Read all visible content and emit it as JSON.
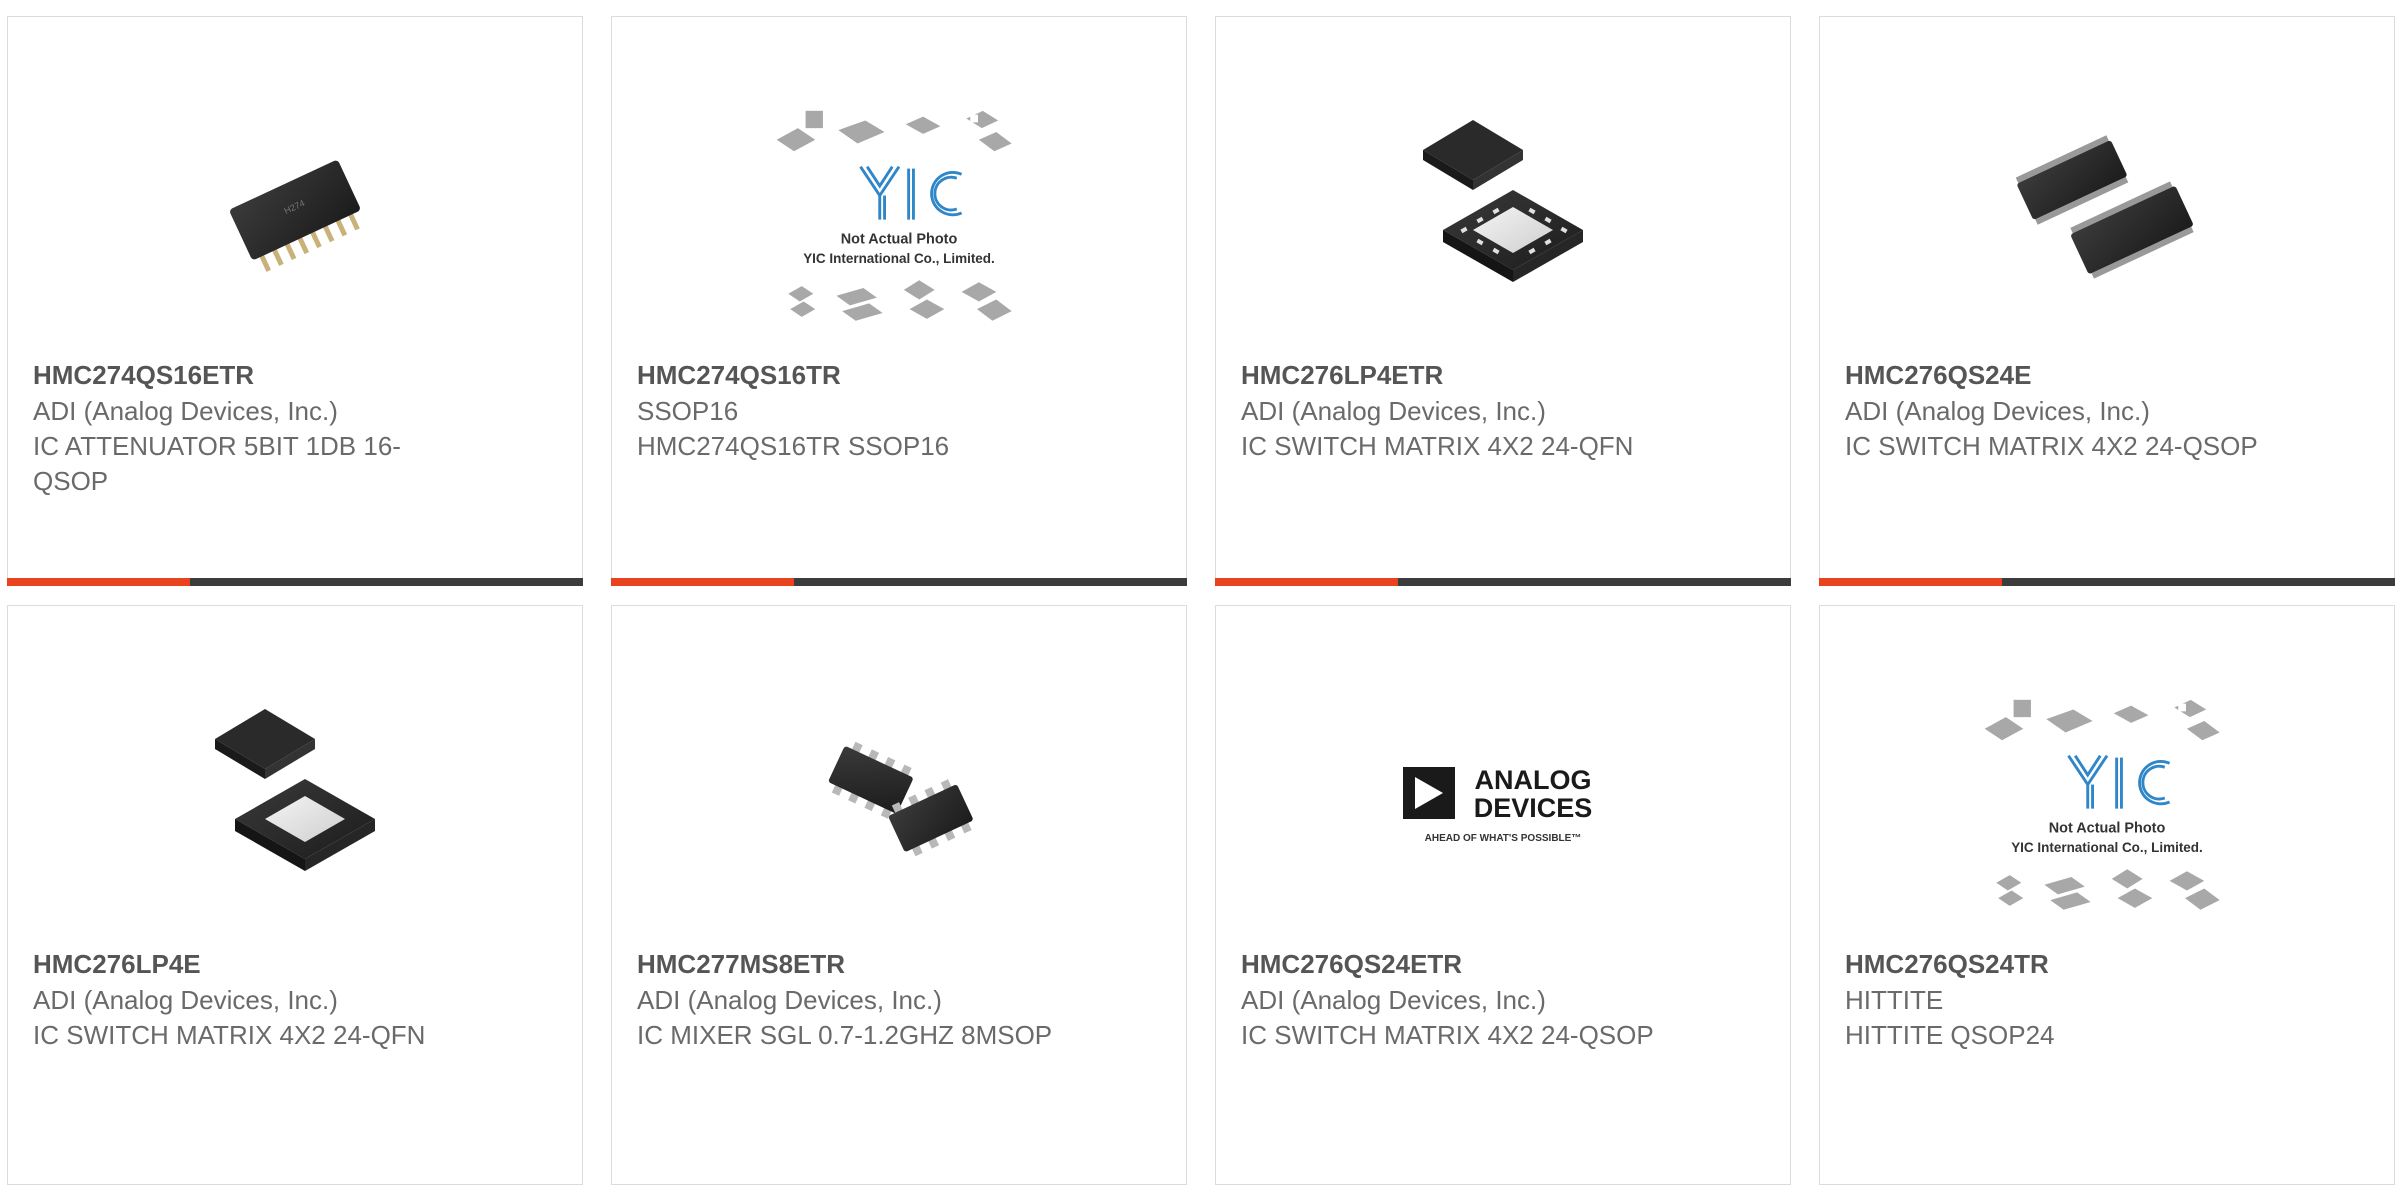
{
  "colors": {
    "accent": "#e8431e",
    "bar": "#3c3c3c",
    "text": "#666666"
  },
  "products": [
    {
      "part": "HMC274QS16ETR",
      "maker": "ADI (Analog Devices, Inc.)",
      "description": "IC ATTENUATOR 5BIT 1DB 16-QSOP",
      "image": "ssop16-chip-photo"
    },
    {
      "part": "HMC274QS16TR",
      "maker": "SSOP16",
      "description": "HMC274QS16TR SSOP16",
      "image": "placeholder-not-actual-photo",
      "placeholder": {
        "logo": "YIC",
        "line1": "Not Actual Photo",
        "line2": "YIC International Co., Limited."
      }
    },
    {
      "part": "HMC276LP4ETR",
      "maker": "ADI (Analog Devices, Inc.)",
      "description": "IC SWITCH MATRIX 4X2 24-QFN",
      "image": "qfn24-chip-photo"
    },
    {
      "part": "HMC276QS24E",
      "maker": "ADI (Analog Devices, Inc.)",
      "description": "IC SWITCH MATRIX 4X2 24-QSOP",
      "image": "qsop24-chip-photo"
    },
    {
      "part": "HMC276LP4E",
      "maker": "ADI (Analog Devices, Inc.)",
      "description": "IC SWITCH MATRIX 4X2 24-QFN",
      "image": "qfn24-chip-photo"
    },
    {
      "part": "HMC277MS8ETR",
      "maker": "ADI (Analog Devices, Inc.)",
      "description": "IC MIXER SGL 0.7-1.2GHZ 8MSOP",
      "image": "msop8-chip-photo"
    },
    {
      "part": "HMC276QS24ETR",
      "maker": "ADI (Analog Devices, Inc.)",
      "description": "IC SWITCH MATRIX 4X2 24-QSOP",
      "image": "analog-devices-logo",
      "logo": {
        "line1": "ANALOG",
        "line2": "DEVICES",
        "tagline": "AHEAD OF WHAT'S POSSIBLE™"
      }
    },
    {
      "part": "HMC276QS24TR",
      "maker": "HITTITE",
      "description": "HITTITE QSOP24",
      "image": "placeholder-not-actual-photo",
      "placeholder": {
        "logo": "YIC",
        "line1": "Not Actual Photo",
        "line2": "YIC International Co., Limited."
      }
    }
  ]
}
